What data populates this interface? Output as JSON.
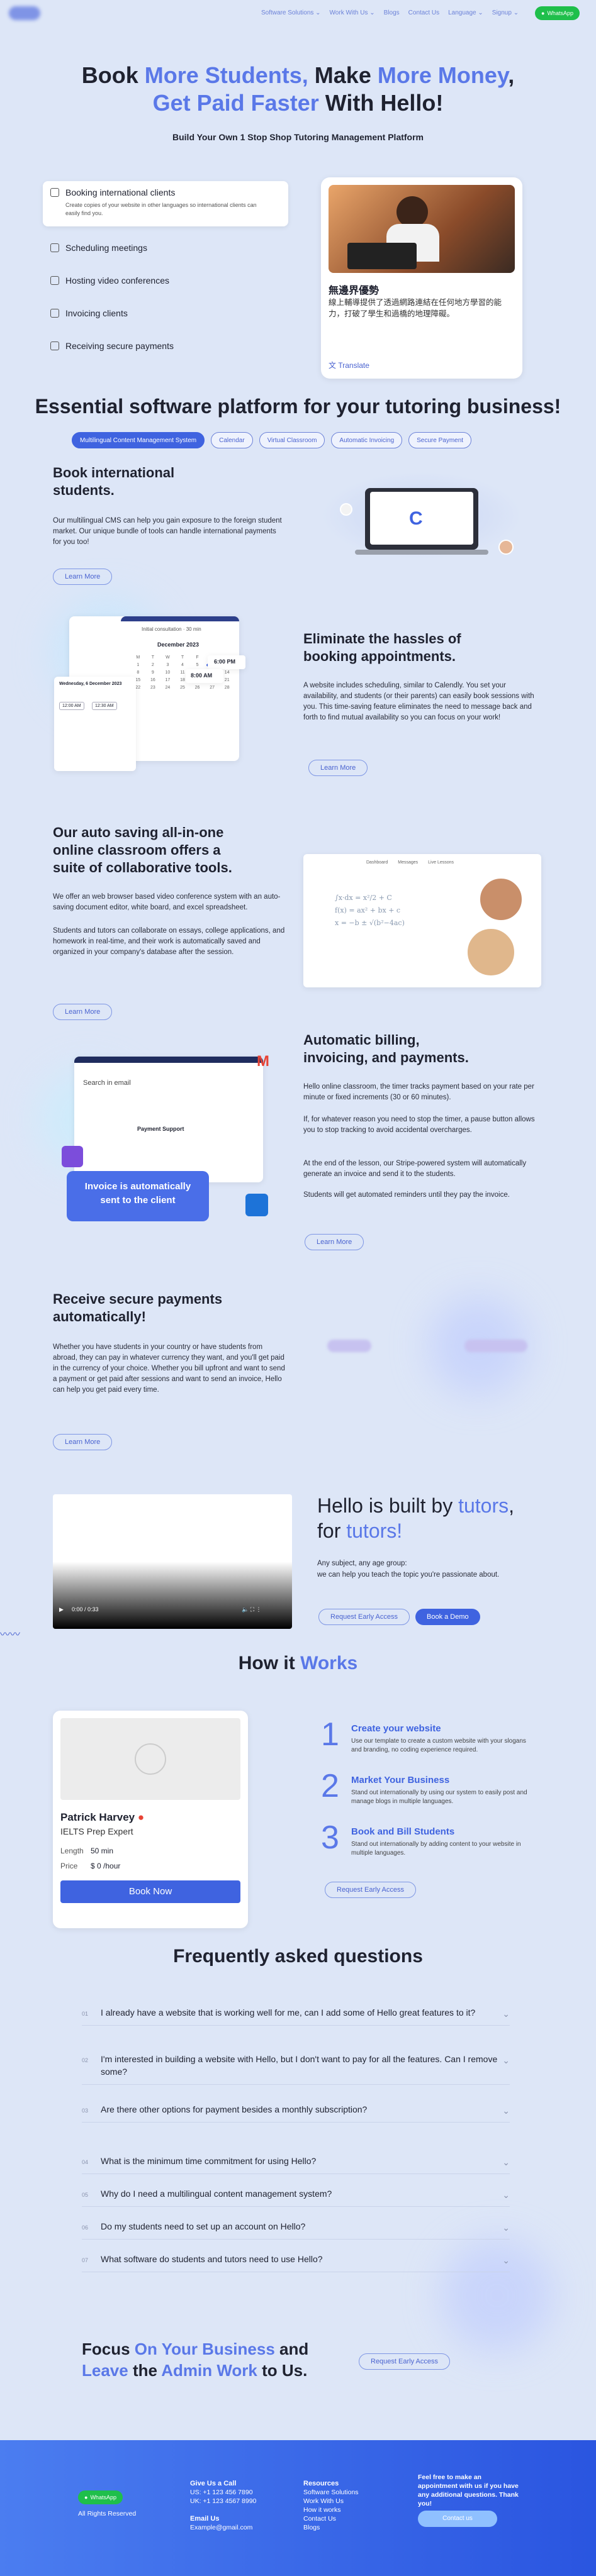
{
  "nav": {
    "links": [
      "Software Solutions ⌄",
      "Work With Us ⌄",
      "Blogs",
      "Contact Us",
      "Language ⌄",
      "Signup ⌄"
    ],
    "whatsapp": "WhatsApp"
  },
  "hero": {
    "l1a": "Book ",
    "l1b": "More Students,",
    "l1c": " Make ",
    "l1d": "More Money",
    ",": ",",
    "l2a": "Get Paid Faster",
    "l2b": " With Hello!",
    "sub": "Build Your Own 1 Stop Shop Tutoring Management Platform",
    "features": [
      {
        "label": "Booking international clients",
        "desc": "Create copies of your website in other languages so international clients can easily find you."
      },
      {
        "label": "Scheduling meetings"
      },
      {
        "label": "Hosting video conferences"
      },
      {
        "label": "Invoicing clients"
      },
      {
        "label": "Receiving secure payments"
      }
    ],
    "card_title": "無邊界優勢",
    "card_text": "線上輔導提供了透過網路連結在任何地方學習的能力，打破了學生和過橋的地理障礙。",
    "translate": "Translate"
  },
  "essential": {
    "title": "Essential software platform for your tutoring business!",
    "tabs": [
      "Multilingual Content Management System",
      "Calendar",
      "Virtual Classroom",
      "Automatic Invoicing",
      "Secure Payment"
    ]
  },
  "s1": {
    "title": "Book international students.",
    "text": "Our multilingual CMS can help you gain exposure to the foreign student market. Our unique bundle of tools can handle international payments for you too!",
    "btn": "Learn More"
  },
  "s2": {
    "title": "Eliminate the hassles of booking appointments.",
    "text": "A website includes scheduling, similar to Calendly. You set your availability, and students (or their parents) can easily book sessions with you. This time-saving feature eliminates the need to message back and forth to find mutual availability so you can focus on your work!",
    "btn": "Learn More",
    "cal_month": "December 2023",
    "cal_head": "Initial consultation",
    "cal_dur": "30 min",
    "date_label": "Wednesday, 6 December 2023",
    "times": [
      "12:00 AM",
      "12:30 AM",
      "6:00 PM",
      "8:00 AM"
    ]
  },
  "s3": {
    "title": "Our auto saving all-in-one online classroom offers a suite of collaborative tools.",
    "t1": "We offer an web browser based video conference system with an auto-saving document editor, white board, and excel spreadsheet.",
    "t2": "Students and tutors can collaborate on essays, college applications, and homework in real-time, and their work is automatically saved and organized in your company's database after the session.",
    "btn": "Learn More",
    "tabs": [
      "Dashboard",
      "Messages",
      "Live Lessons"
    ]
  },
  "s4": {
    "title": "Automatic billing, invoicing, and payments.",
    "t1": "Hello online classroom, the timer tracks payment based on your rate per minute or fixed increments (30 or 60 minutes).",
    "t2": "If, for whatever reason you need to stop the timer, a pause button allows you to stop tracking to avoid accidental overcharges.",
    "t3": "At the end of the lesson, our Stripe-powered system will automatically generate an invoice and send it to the students.",
    "t4": "Students will get automated reminders until they pay the invoice.",
    "btn": "Learn More",
    "search": "Search in email",
    "support": "Payment Support",
    "badge": "Invoice is automatically sent to the client"
  },
  "s5": {
    "title": "Receive secure payments automatically!",
    "text": "Whether you have students in your country or have students from abroad, they can pay in whatever currency they want, and you'll get paid in the currency of your choice. Whether you bill upfront and want to send a payment or get paid after sessions and want to send an invoice, Hello can help you get paid every time.",
    "btn": "Learn More"
  },
  "video": {
    "time": "0:00 / 0:33",
    "h1": "Hello is built by ",
    "h1b": "tutors",
    ",": ",",
    "h2": "for ",
    "h2b": "tutors!",
    "p1": "Any subject, any age group:",
    "p2": "we can help you teach the topic you're passionate about.",
    "b1": "Request Early Access",
    "b2": "Book a Demo"
  },
  "how": {
    "t1": "How it ",
    "t2": "Works",
    "tutor": "Patrick Harvey",
    "exam": "IELTS Prep Expert",
    "len_l": "Length",
    "len_v": "50 min",
    "price_l": "Price",
    "price_v": "$ 0 /hour",
    "book": "Book Now",
    "steps": [
      {
        "n": "1",
        "t": "Create your website",
        "d": "Use our template to create a custom website with your slogans and branding, no coding experience required."
      },
      {
        "n": "2",
        "t": "Market Your Business",
        "d": "Stand out internationally by using our system to easily post and manage blogs in multiple languages."
      },
      {
        "n": "3",
        "t": "Book and Bill Students",
        "d": "Stand out internationally by adding content to your website in multiple languages."
      }
    ],
    "btn": "Request Early Access"
  },
  "faq": {
    "title": "Frequently asked questions",
    "items": [
      {
        "n": "01",
        "q": "I already have a website that is working well for me, can I add some of Hello great features to it?"
      },
      {
        "n": "02",
        "q": "I'm interested in building a website with Hello, but I don't want to pay for all the features. Can I remove some?"
      },
      {
        "n": "03",
        "q": "Are there other options for payment besides a monthly subscription?"
      },
      {
        "n": "04",
        "q": "What is the minimum time commitment for using Hello?"
      },
      {
        "n": "05",
        "q": "Why do I need a multilingual content management system?"
      },
      {
        "n": "06",
        "q": "Do my students need to set up an account on Hello?"
      },
      {
        "n": "07",
        "q": "What software do students and tutors need to use Hello?"
      }
    ]
  },
  "cta": {
    "a": "Focus ",
    "b": "On Your Business",
    "c": " and",
    "d": "Leave",
    "e": " the ",
    "f": "Admin Work",
    "g": " to Us.",
    "btn": "Request Early Access"
  },
  "footer": {
    "wa": "WhatsApp",
    "rights": "All Rights Reserved",
    "call": "Give Us a Call",
    "us": "US: +1 123 456 7890",
    "uk": "UK: +1 123 4567 8990",
    "email_l": "Email Us",
    "email": "Example@gmail.com",
    "res": "Resources",
    "links": [
      "Software Solutions",
      "Work With Us",
      "How it works",
      "Contact Us",
      "Blogs"
    ],
    "free": "Feel free to make an appointment with us if you have any additional questions. Thank you!",
    "contact": "Contact us"
  }
}
